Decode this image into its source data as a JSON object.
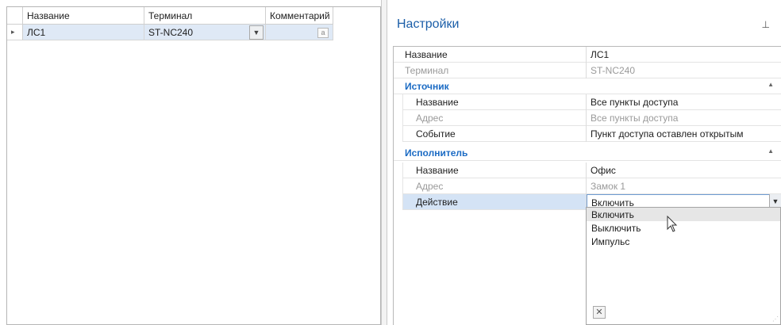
{
  "grid": {
    "headers": [
      "Название",
      "Терминал",
      "Комментарий"
    ],
    "rows": [
      {
        "indicator": "▸",
        "name": "ЛС1",
        "terminal": "ST-NC240",
        "comment_icon": "a"
      }
    ],
    "combo_icon": "chevron-down-icon"
  },
  "settings": {
    "title": "Настройки",
    "pin_icon": "pin-icon",
    "props": [
      {
        "name": "Название",
        "value": "ЛС1"
      },
      {
        "name": "Терминал",
        "value": "ST-NC240"
      }
    ],
    "source": {
      "label": "Источник",
      "props": [
        {
          "name": "Название",
          "value": "Все пункты доступа"
        },
        {
          "name": "Адрес",
          "value": "Все пункты доступа"
        },
        {
          "name": "Событие",
          "value": "Пункт доступа оставлен открытым"
        }
      ]
    },
    "executor": {
      "label": "Исполнитель",
      "props": [
        {
          "name": "Название",
          "value": "Офис"
        },
        {
          "name": "Адрес",
          "value": "Замок 1"
        },
        {
          "name": "Действие",
          "value": "Включить"
        }
      ]
    }
  },
  "dropdown": {
    "options": [
      "Включить",
      "Выключить",
      "Импульс"
    ],
    "highlighted": "Включить",
    "close_icon": "close-icon"
  }
}
